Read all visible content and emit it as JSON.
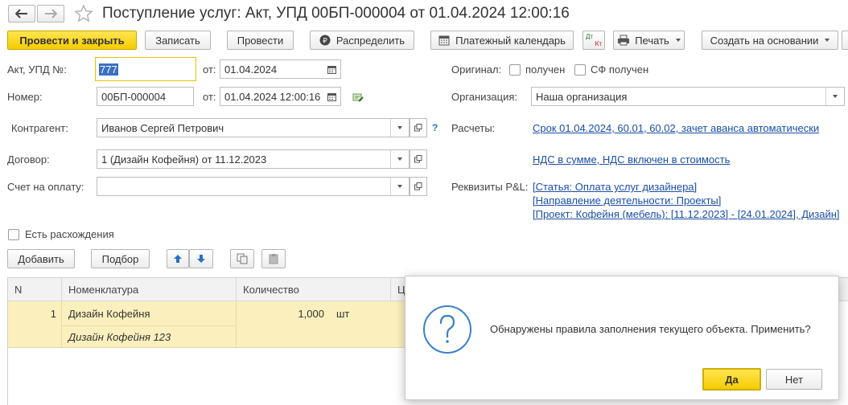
{
  "window": {
    "title": "Поступление услуг: Акт, УПД 00БП-000004 от 01.04.2024 12:00:16"
  },
  "toolbar": {
    "post_close": "Провести и закрыть",
    "save": "Записать",
    "post": "Провести",
    "distribute": "Распределить",
    "payment_calendar": "Платежный календарь",
    "dt_kt_top": "Дт",
    "dt_kt_bottom": "Кт",
    "print": "Печать",
    "create_based": "Создать на основании"
  },
  "form": {
    "act_label": "Акт, УПД №:",
    "act_value": "777",
    "from_label": "от:",
    "act_date": "01.04.2024",
    "number_label": "Номер:",
    "number_value": "00БП-000004",
    "number_date": "01.04.2024 12:00:16",
    "contractor_label": "Контрагент:",
    "contractor_value": "Иванов Сергей Петрович",
    "help": "?",
    "contract_label": "Договор:",
    "contract_value": "1 (Дизайн Кофейня) от 11.12.2023",
    "invoice_label": "Счет на оплату:",
    "invoice_value": "",
    "original_label": "Оригинал:",
    "original_received": "получен",
    "sf_received": "СФ получен",
    "org_label": "Организация:",
    "org_value": "Наша организация",
    "settlements_label": "Расчеты:",
    "settlements_link": "Срок 01.04.2024, 60.01, 60.02, зачет аванса автоматически",
    "vat_link": "НДС в сумме, НДС включен в стоимость",
    "pl_label": "Реквизиты P&L:",
    "pl_article": "[Статья: Оплата услуг дизайнера]",
    "pl_direction": "[Направление деятельности: Проекты]",
    "pl_project": "[Проект: Кофейня (мебель): [11.12.2023] - [24.01.2024], Дизайн]",
    "discrepancy_label": "Есть расхождения"
  },
  "table_toolbar": {
    "add": "Добавить",
    "pick": "Подбор"
  },
  "table": {
    "col_n": "N",
    "col_nomenclature": "Номенклатура",
    "col_qty": "Количество",
    "col_partial": "Ц",
    "rows": [
      {
        "n": "1",
        "name": "Дизайн Кофейня",
        "content": "Дизайн Кофейня 123",
        "qty": "1,000",
        "unit": "шт"
      }
    ]
  },
  "dialog": {
    "message": "Обнаружены правила заполнения текущего объекта. Применить?",
    "yes": "Да",
    "no": "Нет",
    "icon": "question-icon"
  },
  "colors": {
    "accent_yellow": "#f5cc00",
    "link": "#1a4ea8",
    "row_selected": "#fbf0bd"
  }
}
